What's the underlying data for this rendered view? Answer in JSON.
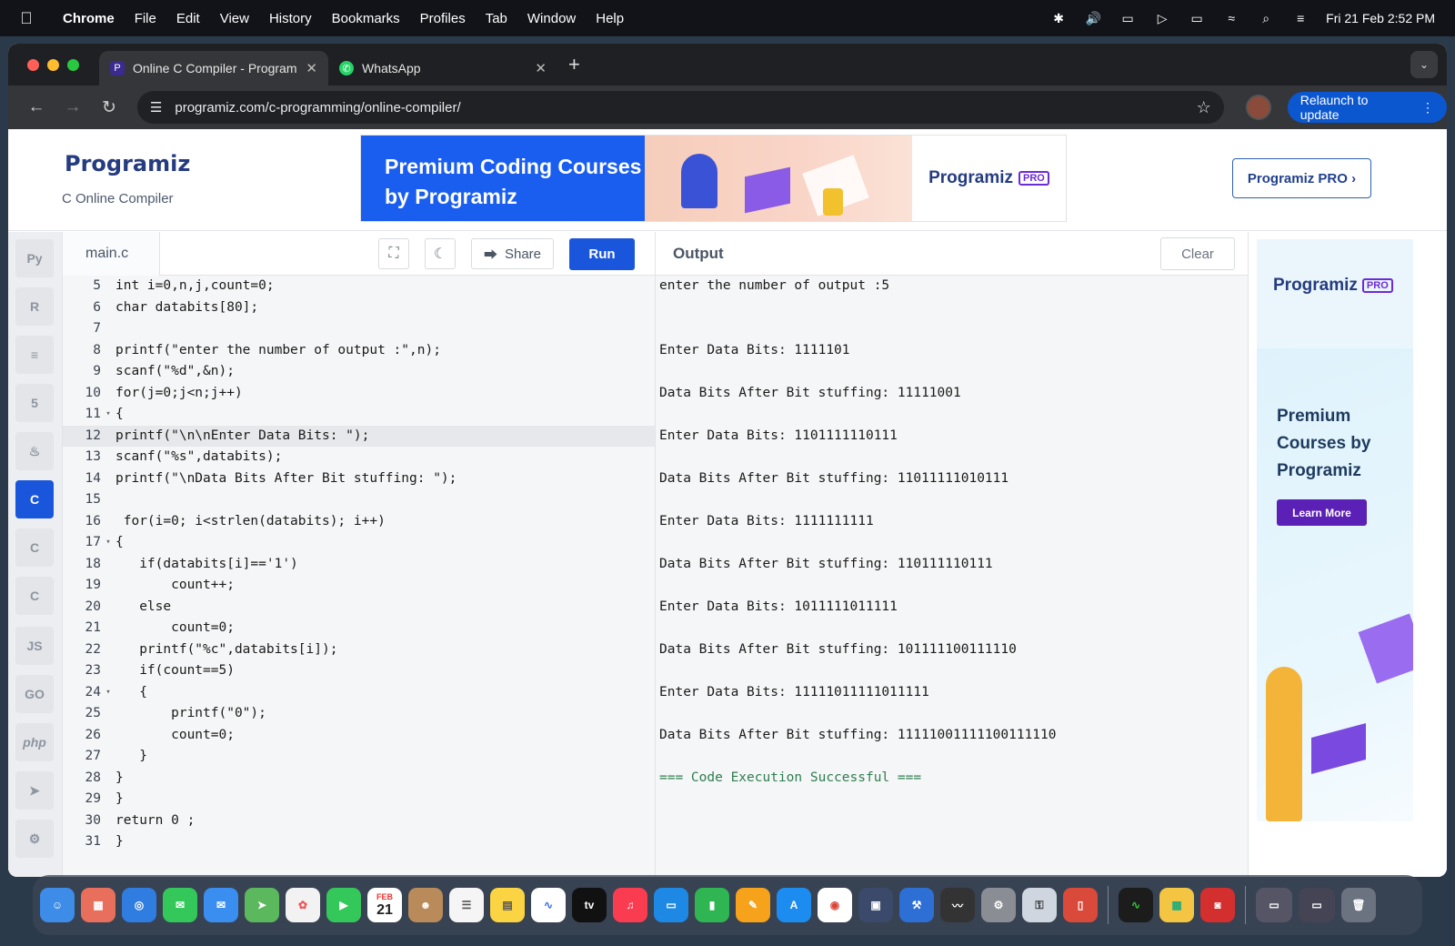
{
  "menubar": {
    "app": "Chrome",
    "items": [
      "File",
      "Edit",
      "View",
      "History",
      "Bookmarks",
      "Profiles",
      "Tab",
      "Window",
      "Help"
    ],
    "clock": "Fri 21 Feb  2:52 PM"
  },
  "browser": {
    "tabs": [
      {
        "title": "Online C Compiler - Programiz"
      },
      {
        "title": "WhatsApp"
      }
    ],
    "url": "programiz.com/c-programming/online-compiler/",
    "relaunch_label": "Relaunch to update"
  },
  "header": {
    "logo_text": "Programiz",
    "subtitle": "C Online Compiler",
    "banner_title": "Premium Coding Courses by Programiz",
    "banner_logo": "Programiz",
    "banner_badge": "PRO",
    "pro_button": "Programiz PRO ›"
  },
  "editor": {
    "filename": "main.c",
    "share_label": "Share",
    "run_label": "Run",
    "highlighted_line": 12,
    "lines": [
      {
        "n": "5",
        "fold": "",
        "text": "int i=0,n,j,count=0;"
      },
      {
        "n": "6",
        "fold": "",
        "text": "char databits[80];"
      },
      {
        "n": "7",
        "fold": "",
        "text": ""
      },
      {
        "n": "8",
        "fold": "",
        "text": "printf(\"enter the number of output :\",n);"
      },
      {
        "n": "9",
        "fold": "",
        "text": "scanf(\"%d\",&n);"
      },
      {
        "n": "10",
        "fold": "",
        "text": "for(j=0;j<n;j++)"
      },
      {
        "n": "11",
        "fold": "▾",
        "text": "{"
      },
      {
        "n": "12",
        "fold": "",
        "text": "printf(\"\\n\\nEnter Data Bits: \");"
      },
      {
        "n": "13",
        "fold": "",
        "text": "scanf(\"%s\",databits);"
      },
      {
        "n": "14",
        "fold": "",
        "text": "printf(\"\\nData Bits After Bit stuffing: \");"
      },
      {
        "n": "15",
        "fold": "",
        "text": ""
      },
      {
        "n": "16",
        "fold": "",
        "text": " for(i=0; i<strlen(databits); i++)"
      },
      {
        "n": "17",
        "fold": "▾",
        "text": "{"
      },
      {
        "n": "18",
        "fold": "",
        "text": "   if(databits[i]=='1')"
      },
      {
        "n": "19",
        "fold": "",
        "text": "       count++;"
      },
      {
        "n": "20",
        "fold": "",
        "text": "   else"
      },
      {
        "n": "21",
        "fold": "",
        "text": "       count=0;"
      },
      {
        "n": "22",
        "fold": "",
        "text": "   printf(\"%c\",databits[i]);"
      },
      {
        "n": "23",
        "fold": "",
        "text": "   if(count==5)"
      },
      {
        "n": "24",
        "fold": "▾",
        "text": "   {"
      },
      {
        "n": "25",
        "fold": "",
        "text": "       printf(\"0\");"
      },
      {
        "n": "26",
        "fold": "",
        "text": "       count=0;"
      },
      {
        "n": "27",
        "fold": "",
        "text": "   }"
      },
      {
        "n": "28",
        "fold": "",
        "text": "}"
      },
      {
        "n": "29",
        "fold": "",
        "text": "}"
      },
      {
        "n": "30",
        "fold": "",
        "text": "return 0 ;"
      },
      {
        "n": "31",
        "fold": "",
        "text": "}"
      }
    ]
  },
  "output": {
    "title": "Output",
    "clear_label": "Clear",
    "lines": [
      "enter the number of output :5",
      "",
      "",
      "Enter Data Bits: 1111101",
      "",
      "Data Bits After Bit stuffing: 11111001",
      "",
      "Enter Data Bits: 1101111110111",
      "",
      "Data Bits After Bit stuffing: 11011111010111",
      "",
      "Enter Data Bits: 1111111111",
      "",
      "Data Bits After Bit stuffing: 110111110111",
      "",
      "Enter Data Bits: 1011111011111",
      "",
      "Data Bits After Bit stuffing: 101111100111110",
      "",
      "Enter Data Bits: 11111011111011111",
      "",
      "Data Bits After Bit stuffing: 11111001111100111110",
      "",
      "=== Code Execution Successful ==="
    ]
  },
  "side_ad": {
    "logo": "Programiz",
    "badge": "PRO",
    "headline": "Premium Courses by Programiz",
    "button": "Learn More"
  },
  "languages": [
    "python-icon",
    "r-icon",
    "sql-icon",
    "html-icon",
    "java-icon",
    "c-icon",
    "cpp-icon",
    "csharp-icon",
    "js-icon",
    "go-icon",
    "php-icon",
    "swift-icon",
    "rust-icon"
  ],
  "dock_calendar": {
    "month": "FEB",
    "day": "21"
  },
  "colors": {
    "accent": "#1a56db",
    "success": "#2e7d4f",
    "brand_purple": "#6c2bd9"
  }
}
